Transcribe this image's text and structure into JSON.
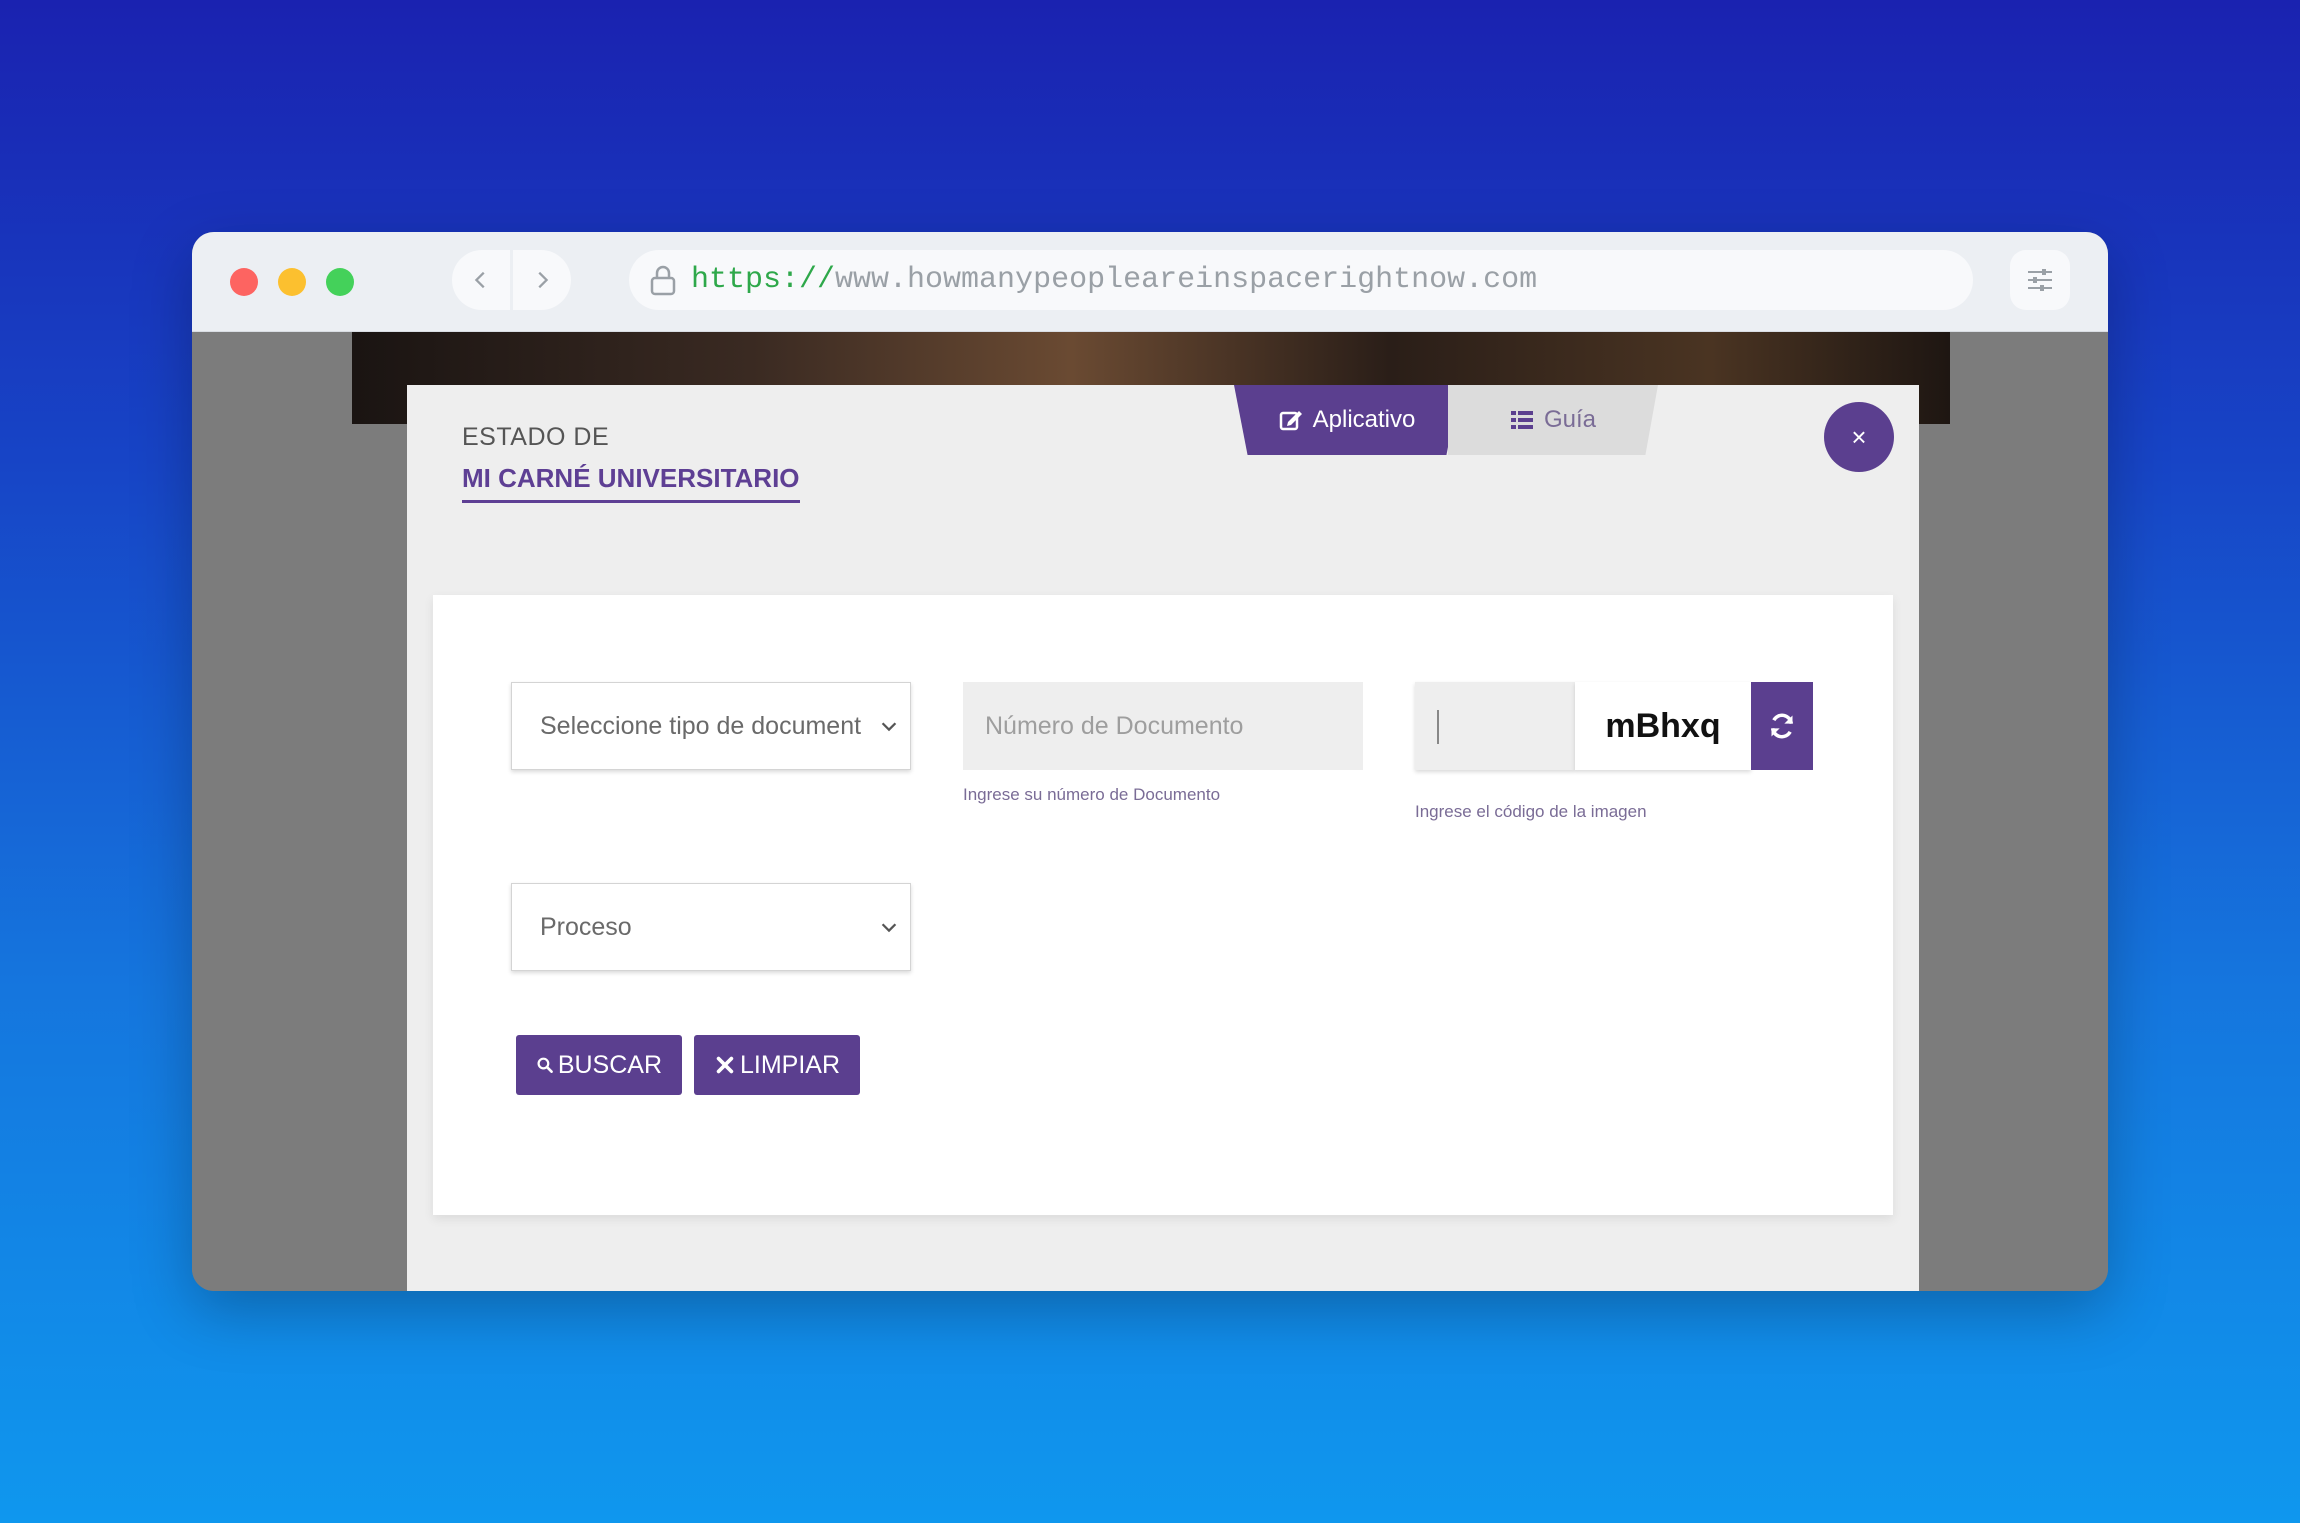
{
  "browser": {
    "url_scheme": "https://",
    "url_rest": "www.howmanypeopleareinspacerightnow.com"
  },
  "modal": {
    "title_small": "ESTADO DE",
    "title_big": "MI CARNÉ UNIVERSITARIO",
    "tabs": [
      {
        "label": "Aplicativo",
        "icon": "edit-icon",
        "active": true
      },
      {
        "label": "Guía",
        "icon": "list-icon",
        "active": false
      }
    ],
    "close_label": "×"
  },
  "form": {
    "doc_type_select": "Seleccione tipo de document",
    "doc_number_placeholder": "Número de Documento",
    "doc_number_help": "Ingrese su número de Documento",
    "captcha_text": "mBhxq",
    "captcha_help": "Ingrese el código de la imagen",
    "process_select": "Proceso",
    "search_label": "BUSCAR",
    "clear_label": "LIMPIAR"
  },
  "colors": {
    "accent": "#5b3f8f",
    "url_scheme": "#2ea84a"
  }
}
